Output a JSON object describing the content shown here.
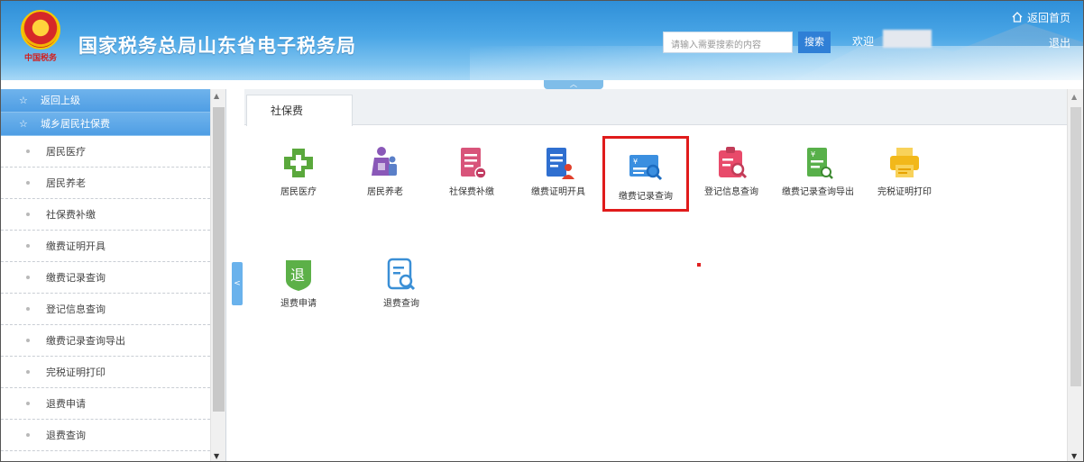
{
  "header": {
    "site_title": "国家税务总局山东省电子税务局",
    "search_placeholder": "请输入需要搜索的内容",
    "search_button": "搜索",
    "welcome": "欢迎",
    "home_link": "返回首页",
    "logout": "退出"
  },
  "sidebar": {
    "back": "返回上级",
    "section": "城乡居民社保费",
    "items": [
      {
        "label": "居民医疗"
      },
      {
        "label": "居民养老"
      },
      {
        "label": "社保费补缴"
      },
      {
        "label": "缴费证明开具"
      },
      {
        "label": "缴费记录查询"
      },
      {
        "label": "登记信息查询"
      },
      {
        "label": "缴费记录查询导出"
      },
      {
        "label": "完税证明打印"
      },
      {
        "label": "退费申请"
      },
      {
        "label": "退费查询"
      }
    ]
  },
  "main": {
    "tab_label": "社保费",
    "tiles": [
      {
        "label": "居民医疗",
        "icon": "medical-cross-icon",
        "color": "#5aa83c"
      },
      {
        "label": "居民养老",
        "icon": "elderly-people-icon",
        "color": "#8a58b8"
      },
      {
        "label": "社保费补缴",
        "icon": "document-add-icon",
        "color": "#d8547a"
      },
      {
        "label": "缴费证明开具",
        "icon": "document-person-icon",
        "color": "#2f6fd0"
      },
      {
        "label": "缴费记录查询",
        "icon": "card-search-icon",
        "color": "#3b8fe0",
        "selected": true
      },
      {
        "label": "登记信息查询",
        "icon": "clipboard-search-icon",
        "color": "#e84a6a"
      },
      {
        "label": "缴费记录查询导出",
        "icon": "document-export-icon",
        "color": "#58b04a"
      },
      {
        "label": "完税证明打印",
        "icon": "printer-icon",
        "color": "#f2b81a"
      },
      {
        "label": "退费申请",
        "icon": "refund-shield-icon",
        "color": "#5cb048"
      },
      {
        "label": "退费查询",
        "icon": "document-search-icon",
        "color": "#3a8fd6"
      }
    ]
  },
  "logo": {
    "seal_text": "中国税务"
  }
}
